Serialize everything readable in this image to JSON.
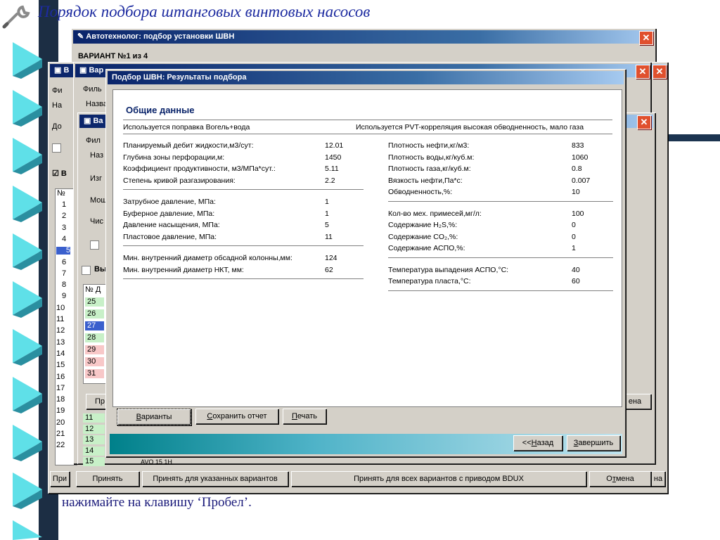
{
  "slide": {
    "title": "Порядок подбора штанговых винтовых насосов",
    "bullet_text": "нажимайте на клавишу ‘Пробел’."
  },
  "main_window": {
    "title": "Автотехнолог: подбор установки ШВН",
    "variant": "ВАРИАНТ №1 из 4"
  },
  "variant_windows": {
    "title_prefix_a": "В",
    "title_prefix_b": "Вар",
    "title_prefix_c": "Ва",
    "filter_labels": [
      "Фи",
      "Филь",
      "Фил"
    ],
    "field_labels": [
      "На",
      "Назва",
      "Наз",
      "До",
      "Изг",
      "Мощ",
      "Чис"
    ],
    "checkbox_labels": [
      "В",
      "Вы"
    ],
    "table_header": "№",
    "table_header_b": "№ Д",
    "row_numbers_outer": [
      "1",
      "2",
      "3",
      "4",
      "5",
      "6",
      "7",
      "8",
      "9",
      "10",
      "11",
      "12",
      "13",
      "14",
      "15",
      "16",
      "17",
      "18",
      "19",
      "20",
      "21",
      "22"
    ],
    "row_numbers_inner": [
      "25",
      "26",
      "27",
      "28",
      "29",
      "30",
      "31"
    ],
    "row_numbers_lower": [
      "11",
      "12",
      "13",
      "14",
      "15"
    ],
    "lower_row_fragment": "AVO 15 1H"
  },
  "back_buttons": {
    "pri": "При",
    "pr": "Пр",
    "accept": "Принять",
    "accept_selected": "Принять для указанных вариантов",
    "accept_all_bdux": "Принять для всех вариантов с приводом BDUX",
    "cancel": "Отмена",
    "cancel_mnemonic_pre": "О",
    "cancel_mnemonic": "т",
    "cancel_mnemonic_post": "мена",
    "na_right": "на",
    "na_right_2": "ена"
  },
  "dialog": {
    "title": "Подбор ШВН: Результаты подбора",
    "section": "Общие данные",
    "header_left": "Используется поправка Вогель+вода",
    "header_right": "Используется PVT-корреляция высокая обводненность, мало газа",
    "left_rows_1": [
      {
        "label": "Планируемый дебит жидкости,м3/сут:",
        "value": "12.01"
      },
      {
        "label": "Глубина зоны перфорации,м:",
        "value": "1450"
      },
      {
        "label": "Коэффициент продуктивности, м3/МПа*сут.:",
        "value": "5.11"
      },
      {
        "label": "Степень кривой разгазирования:",
        "value": "2.2"
      }
    ],
    "left_rows_2": [
      {
        "label": "Затрубное давление, МПа:",
        "value": "1"
      },
      {
        "label": "Буферное давление, МПа:",
        "value": "1"
      },
      {
        "label": "Давление насыщения, МПа:",
        "value": "5"
      },
      {
        "label": "Пластовое давление, МПа:",
        "value": "11"
      }
    ],
    "left_rows_3": [
      {
        "label": "Мин. внутренний диаметр обсадной колонны,мм:",
        "value": "124"
      },
      {
        "label": "Мин. внутренний диаметр НКТ, мм:",
        "value": "62"
      }
    ],
    "right_rows_1": [
      {
        "label": "Плотность нефти,кг/м3:",
        "value": "833"
      },
      {
        "label": "Плотность воды,кг/куб.м:",
        "value": "1060"
      },
      {
        "label": "Плотность газа,кг/куб.м:",
        "value": "0.8"
      },
      {
        "label": "Вязкость нефти,Па*с:",
        "value": "0.007"
      },
      {
        "label": "Обводненность,%:",
        "value": "10"
      }
    ],
    "right_rows_2": [
      {
        "label": "Кол-во мех. примесей,мг/л:",
        "value": "100"
      },
      {
        "label": "Содержание H₂S,%:",
        "value": "0"
      },
      {
        "label": "Содержание CO₂,%:",
        "value": "0"
      },
      {
        "label": "Содержание АСПО,%:",
        "value": "1"
      }
    ],
    "right_rows_3": [
      {
        "label": "Температура выпадения АСПО,°С:",
        "value": "40"
      },
      {
        "label": "Температура пласта,°С:",
        "value": "60"
      }
    ],
    "buttons": {
      "variants": "Варианты",
      "variants_m": "В",
      "variants_rest": "арианты",
      "save_report": "Сохранить отчет",
      "save_m": "С",
      "save_rest": "охранить отчет",
      "print": "Печать",
      "print_m": "П",
      "print_rest": "ечать",
      "back_pre": "<<",
      "back_m": "Н",
      "back_rest": "азад",
      "finish_m": "З",
      "finish_rest": "авершить"
    }
  },
  "colors": {
    "title_blue": "#1d2ba0",
    "title_bar": "#0a246a",
    "close_red": "#e0502e",
    "row_green": "#c8f0c8",
    "row_pink": "#f8c8c8",
    "row_selected": "#3a5fcd"
  }
}
